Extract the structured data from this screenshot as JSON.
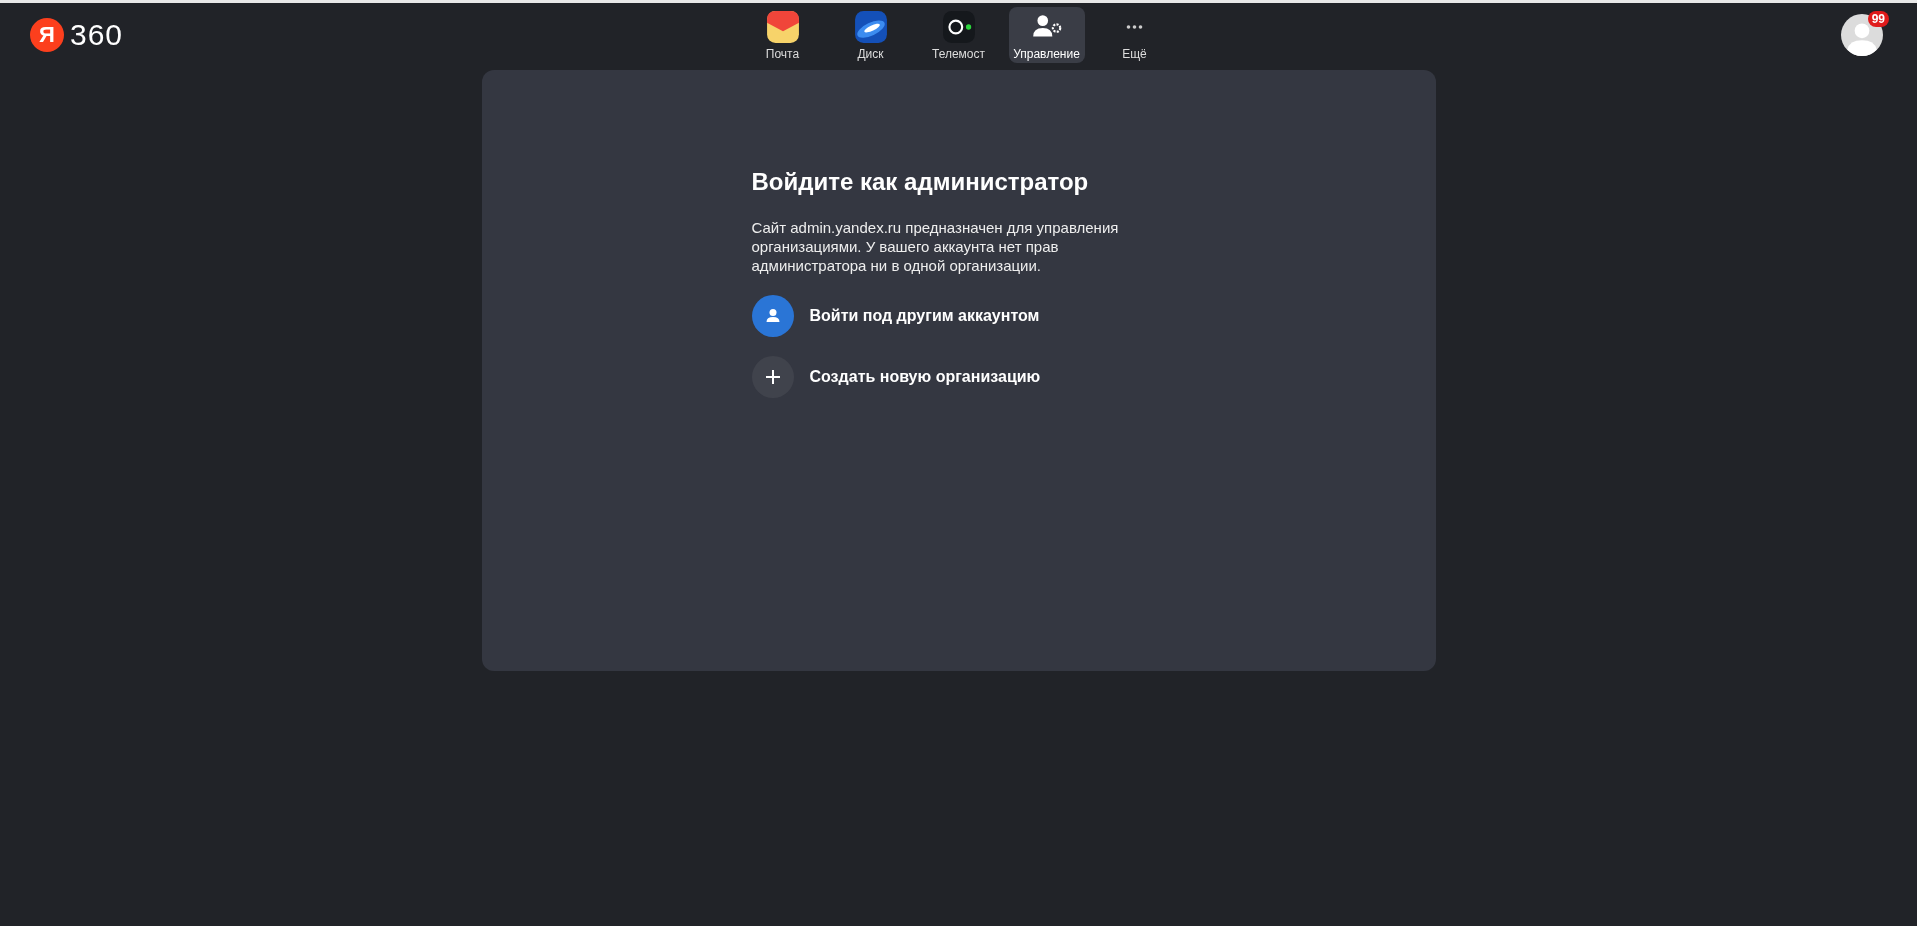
{
  "logo": {
    "mark": "Я",
    "text": "360"
  },
  "apps": [
    {
      "kind": "mail",
      "label": "Почта",
      "selected": false
    },
    {
      "kind": "disk",
      "label": "Диск",
      "selected": false
    },
    {
      "kind": "telemost",
      "label": "Телемост",
      "selected": false
    },
    {
      "kind": "admin",
      "label": "Управление",
      "selected": true
    },
    {
      "kind": "more",
      "label": "Ещё",
      "selected": false
    }
  ],
  "profile": {
    "badge": "99"
  },
  "card": {
    "title": "Войдите как администратор",
    "description": "Сайт admin.yandex.ru предназначен для управления организациями. У вашего аккаунта нет прав администратора ни в одной организации.",
    "actions": [
      {
        "kind": "account",
        "label": "Войти под другим аккаунтом"
      },
      {
        "kind": "create",
        "label": "Создать новую организацию"
      }
    ]
  }
}
